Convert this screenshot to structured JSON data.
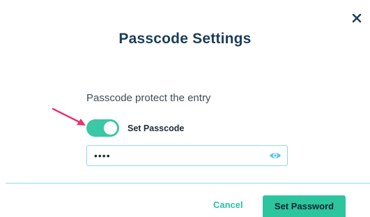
{
  "dialog": {
    "title": "Passcode Settings",
    "close_icon": "close-icon"
  },
  "passcode": {
    "protect_label": "Passcode protect the entry",
    "toggle_label": "Set Passcode",
    "toggle_on": true,
    "value": "••••",
    "eye_icon": "eye-icon"
  },
  "footer": {
    "cancel_label": "Cancel",
    "primary_label": "Set Password"
  },
  "colors": {
    "accent": "#2cc59e",
    "title": "#1c3d5a",
    "annotation_arrow": "#e8336d"
  }
}
